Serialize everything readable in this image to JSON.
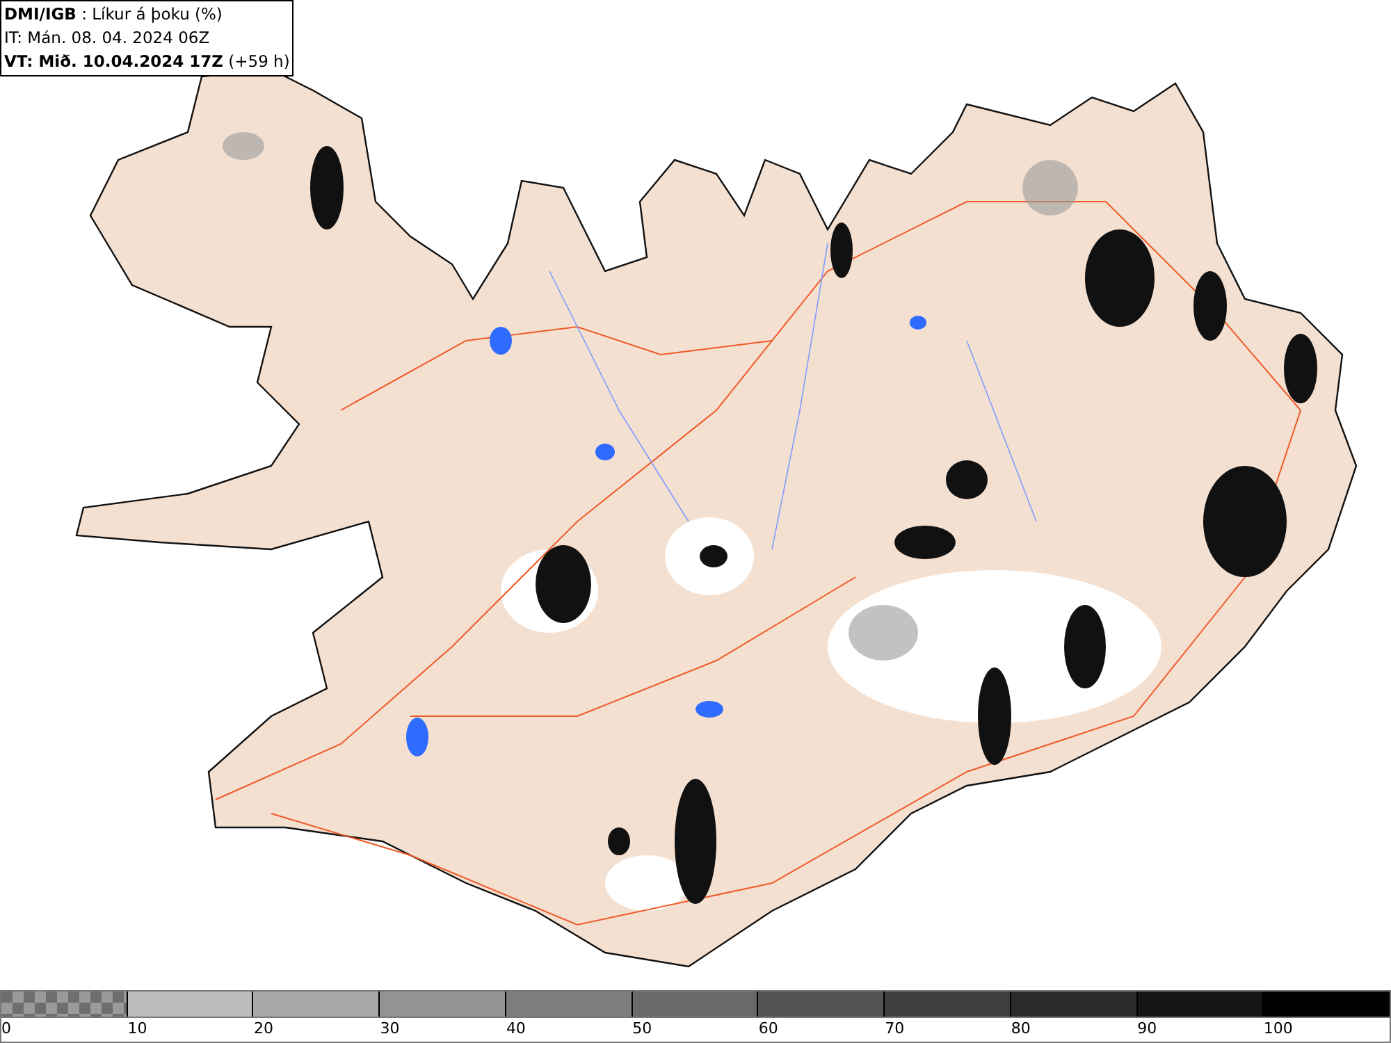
{
  "header": {
    "title": "**DMI/IGB** : Líkur á þoku (%)",
    "issue_time": "IT: Mán. 08. 04. 2024 06Z",
    "valid_time": "**VT: Mið. 10.04.2024 17Z** (+59 h)"
  },
  "legend": {
    "segments": [
      {
        "kind": "checker",
        "color": "#6e6e6e"
      },
      {
        "kind": "solid",
        "color": "#bdbdbd"
      },
      {
        "kind": "solid",
        "color": "#a8a8a8"
      },
      {
        "kind": "solid",
        "color": "#939393"
      },
      {
        "kind": "solid",
        "color": "#7e7e7e"
      },
      {
        "kind": "solid",
        "color": "#696969"
      },
      {
        "kind": "solid",
        "color": "#545454"
      },
      {
        "kind": "solid",
        "color": "#3f3f3f"
      },
      {
        "kind": "solid",
        "color": "#2a2a2a"
      },
      {
        "kind": "solid",
        "color": "#151515"
      },
      {
        "kind": "solid",
        "color": "#000000"
      }
    ],
    "labels": [
      "0",
      "10",
      "20",
      "30",
      "40",
      "50",
      "60",
      "70",
      "80",
      "90",
      "100"
    ]
  }
}
